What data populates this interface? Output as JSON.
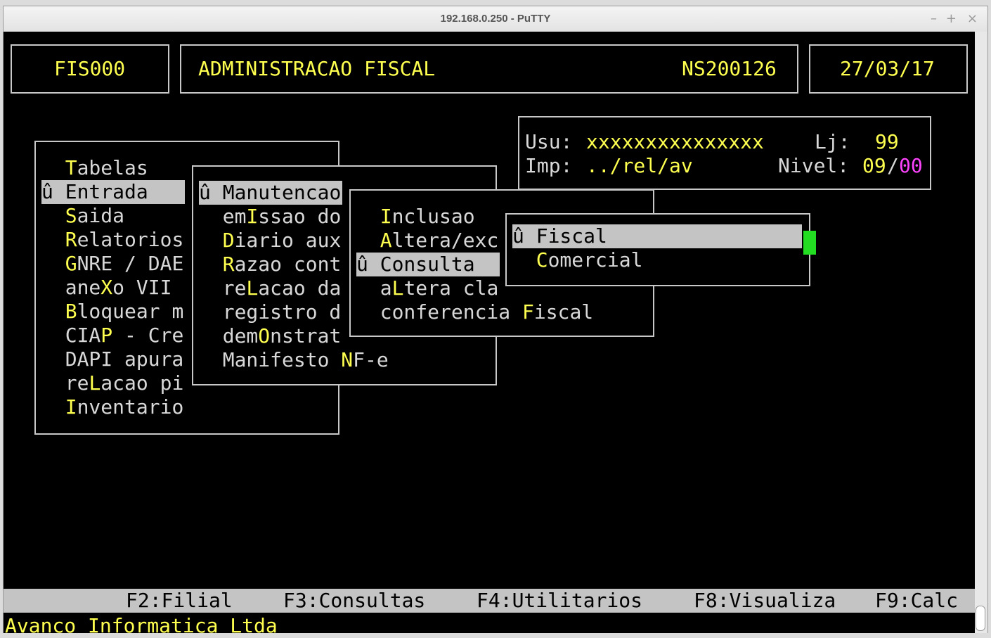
{
  "window": {
    "title": "192.168.0.250 - PuTTY",
    "minimize": "–",
    "maximize": "+",
    "close": "×"
  },
  "header": {
    "code": "FIS000",
    "name": "ADMINISTRACAO FISCAL",
    "version": "NS200126",
    "date": "27/03/17"
  },
  "info": {
    "usu_label": "Usu:",
    "usu_value": "xxxxxxxxxxxxxxx",
    "lj_label": "Lj:",
    "lj_value": "99",
    "imp_label": "Imp:",
    "imp_value": "../rel/av",
    "nivel_label": "Nivel:",
    "nivel_value": "09",
    "nivel_sep": "/",
    "nivel_value2": "00"
  },
  "marker": "û",
  "menu1": [
    {
      "pre": "",
      "key": "T",
      "post": "abelas"
    },
    {
      "pre": "",
      "key": "E",
      "post": "ntrada",
      "selected": true
    },
    {
      "pre": "",
      "key": "S",
      "post": "aida"
    },
    {
      "pre": "",
      "key": "R",
      "post": "elatorios"
    },
    {
      "pre": "",
      "key": "G",
      "post": "NRE / DAE"
    },
    {
      "pre": "ane",
      "key": "X",
      "post": "o VII"
    },
    {
      "pre": "",
      "key": "B",
      "post": "loquear m"
    },
    {
      "pre": "CIA",
      "key": "P",
      "post": " - Cre"
    },
    {
      "pre": "DAPI apura",
      "key": "",
      "post": ""
    },
    {
      "pre": "re",
      "key": "L",
      "post": "acao pi"
    },
    {
      "pre": "",
      "key": "I",
      "post": "nventario"
    }
  ],
  "menu2": [
    {
      "pre": "",
      "key": "M",
      "post": "anutencao",
      "selected": true
    },
    {
      "pre": "em",
      "key": "I",
      "post": "ssao do"
    },
    {
      "pre": "",
      "key": "D",
      "post": "iario aux"
    },
    {
      "pre": "",
      "key": "R",
      "post": "azao cont"
    },
    {
      "pre": "re",
      "key": "L",
      "post": "acao da"
    },
    {
      "pre": "registro d",
      "key": "",
      "post": ""
    },
    {
      "pre": "dem",
      "key": "O",
      "post": "nstrat"
    },
    {
      "pre": "Manifesto ",
      "key": "N",
      "post": "F-e"
    }
  ],
  "menu3": [
    {
      "pre": "",
      "key": "I",
      "post": "nclusao"
    },
    {
      "pre": "",
      "key": "A",
      "post": "ltera/exc"
    },
    {
      "pre": "",
      "key": "C",
      "post": "onsulta",
      "selected": true
    },
    {
      "pre": "a",
      "key": "L",
      "post": "tera cla"
    },
    {
      "pre": "conferencia ",
      "key": "F",
      "post": "iscal"
    }
  ],
  "menu4": [
    {
      "pre": "",
      "key": "F",
      "post": "iscal",
      "selected": true
    },
    {
      "pre": "",
      "key": "C",
      "post": "omercial"
    }
  ],
  "fkeys": [
    "F2:Filial",
    "F3:Consultas",
    "F4:Utilitarios",
    "F8:Visualiza",
    "F9:Calc"
  ],
  "status": "Avanco Informatica Ltda",
  "colors": {
    "highlight_key": "#ffff50",
    "accent_magenta": "#ff44ff",
    "cursor": "#22dd22",
    "selection_bg": "#c4c4c4"
  }
}
